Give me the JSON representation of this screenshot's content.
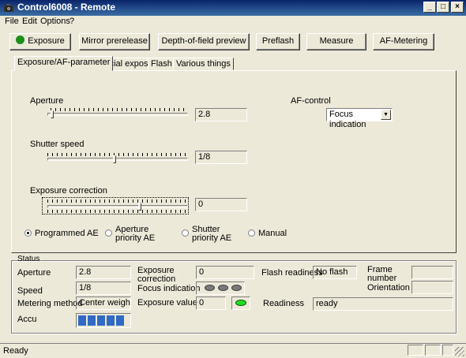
{
  "window": {
    "title": "Control6008 - Remote"
  },
  "menu": [
    "File",
    "Edit",
    "Options",
    "?"
  ],
  "toolbar": {
    "buttons": [
      "Exposure",
      "Mirror prerelease",
      "Depth-of-field preview",
      "Preflash",
      "Measure",
      "AF-Metering"
    ]
  },
  "tabs": [
    "Exposure/AF-parameter",
    "Special exposure",
    "Flash",
    "Various things"
  ],
  "exposure": {
    "aperture_label": "Aperture",
    "aperture_value": "2.8",
    "shutter_label": "Shutter speed",
    "shutter_value": "1/8",
    "correction_label": "Exposure correction",
    "correction_value": "0",
    "af_label": "AF-control",
    "af_value": "Focus indication",
    "modes": [
      {
        "label": "Programmed AE",
        "selected": true
      },
      {
        "label": "Aperture priority AE",
        "selected": false
      },
      {
        "label": "Shutter priority AE",
        "selected": false
      },
      {
        "label": "Manual",
        "selected": false
      }
    ]
  },
  "status": {
    "group_label": "Status",
    "aperture_label": "Aperture",
    "aperture_value": "2.8",
    "speed_label": "Speed",
    "speed_value": "1/8",
    "metering_label": "Metering method",
    "metering_value": "Center weighted",
    "accu_label": "Accu",
    "exposure_correction_label": "Exposure correction",
    "exposure_correction_value": "0",
    "focus_indication_label": "Focus indication",
    "exposure_value_label": "Exposure value",
    "exposure_value_value": "0",
    "flash_readiness_label": "Flash readiness",
    "flash_readiness_value": "No flash",
    "frame_number_label": "Frame number",
    "frame_number_value": "",
    "orientation_label": "Orientation",
    "orientation_value": "",
    "readiness_label": "Readiness",
    "readiness_value": "ready"
  },
  "statusbar": {
    "text": "Ready"
  },
  "colors": {
    "accent": "#316ac5",
    "led_ok": "#22dd22",
    "titlebar": "#0a246a"
  }
}
